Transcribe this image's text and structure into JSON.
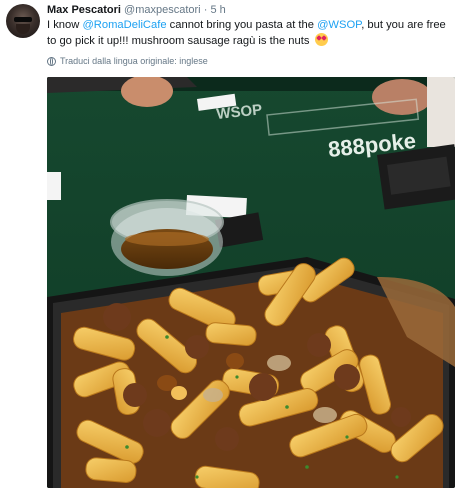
{
  "tweet": {
    "name": "Max Pescatori",
    "handle": "@maxpescatori",
    "dot": "·",
    "time": "5 h",
    "text_1": "I know ",
    "mention_1": "@RomaDeliCafe",
    "text_2": " cannot bring you pasta at the ",
    "mention_2": "@WSOP",
    "text_3": ", but you are free to go pick it up!!! mushroom sausage ragù is the nuts",
    "emoji": "heart-eyes",
    "translate": "Traduci dalla lingua originale: inglese",
    "photo_table_text": "888poke"
  },
  "colors": {
    "link": "#1da1f2",
    "secondary": "#657786",
    "felt": "#1d5e3c"
  }
}
